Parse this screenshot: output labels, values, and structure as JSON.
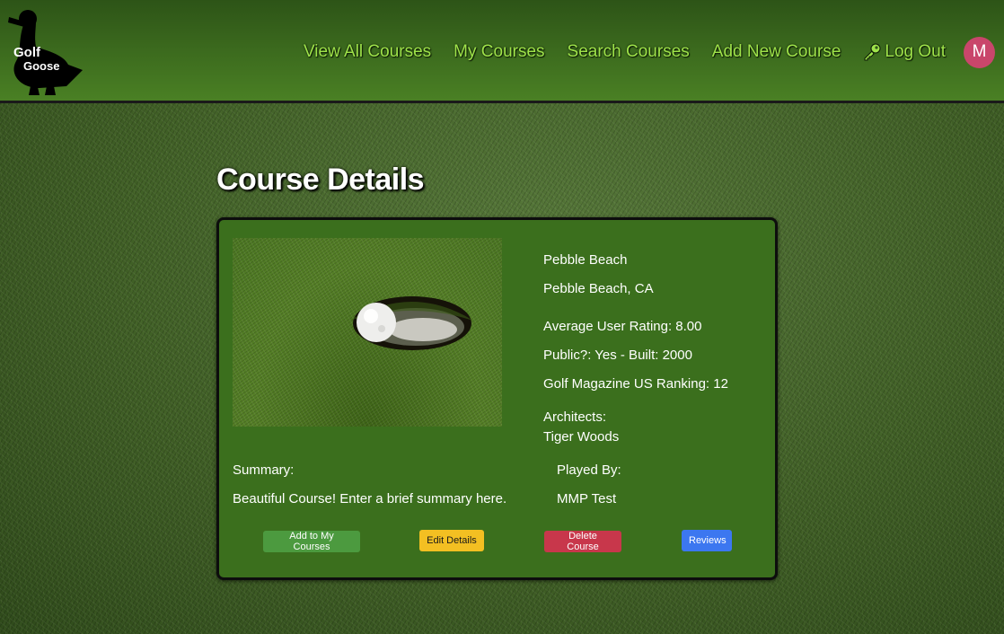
{
  "brand": {
    "logo_line1": "Golf",
    "logo_line2": "Goose"
  },
  "nav": {
    "view_all": "View All Courses",
    "my_courses": "My Courses",
    "search": "Search Courses",
    "add_new": "Add New Course",
    "logout": "Log Out",
    "logout_icon": "key-icon",
    "avatar_initial": "M",
    "avatar_color": "#c9466b",
    "link_color": "#9fe34a"
  },
  "page": {
    "title": "Course Details"
  },
  "course": {
    "name": "Pebble Beach",
    "location": "Pebble Beach, CA",
    "avg_rating": "Average User Rating: 8.00",
    "public_built": "Public?: Yes - Built: 2000",
    "ranking": "Golf Magazine US Ranking: 12",
    "architects_label": "Architects:",
    "architects": "Tiger Woods",
    "summary_label": "Summary:",
    "summary": "Beautiful Course! Enter a brief summary here.",
    "played_by_label": "Played By:",
    "played_by": "MMP Test"
  },
  "actions": {
    "add": "Add to My Courses",
    "edit": "Edit Details",
    "delete": "Delete Course",
    "reviews": "Reviews"
  }
}
